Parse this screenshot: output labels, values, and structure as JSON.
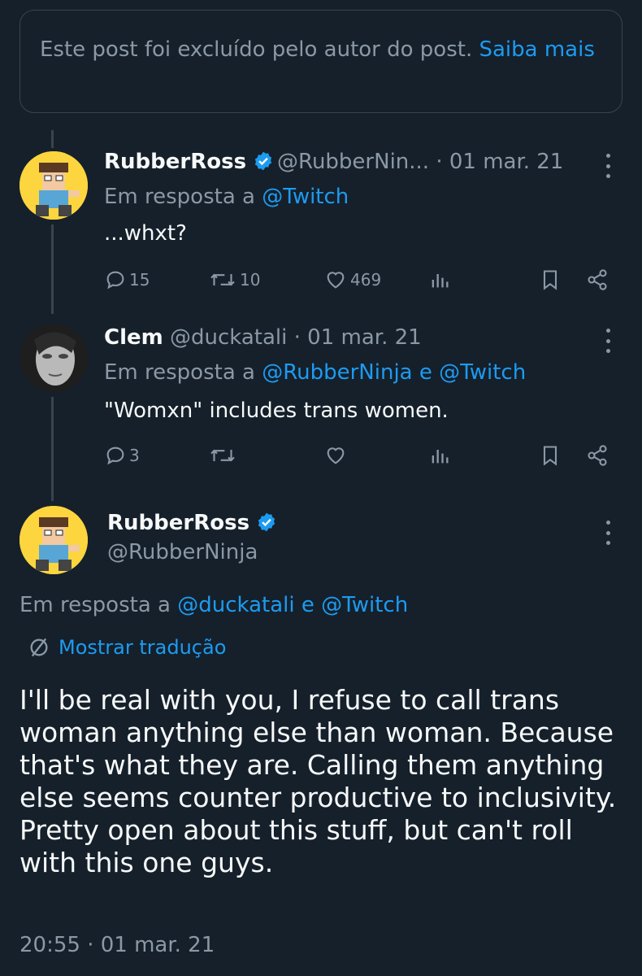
{
  "deleted_notice": {
    "text": "Este post foi excluído pelo autor do post.",
    "link": "Saiba mais"
  },
  "tweets": [
    {
      "name": "RubberRoss",
      "handle": "@RubberNin...",
      "date": "01 mar. 21",
      "reply_prefix": "Em resposta a",
      "reply_to": "@Twitch",
      "text": "...whxt?",
      "replies": "15",
      "retweets": "10",
      "likes": "469"
    },
    {
      "name": "Clem",
      "handle": "@duckatali",
      "date": "01 mar. 21",
      "reply_prefix": "Em resposta a",
      "reply_to": "@RubberNinja e @Twitch",
      "text": "\"Womxn\" includes trans women.",
      "replies": "3",
      "retweets": "",
      "likes": ""
    }
  ],
  "main_tweet": {
    "name": "RubberRoss",
    "handle": "@RubberNinja",
    "reply_prefix": "Em resposta a",
    "reply_to": "@duckatali e @Twitch",
    "translate_label": "Mostrar tradução",
    "text": "I'll be real with you, I refuse to call trans woman anything else than woman. Because that's what they are. Calling them anything else seems counter productive to inclusivity. Pretty open about this stuff, but can't roll with this one guys.",
    "timestamp": "20:55 · 01 mar. 21"
  },
  "colors": {
    "background": "#15202b",
    "accent": "#1d9bf0",
    "muted": "#8b98a5",
    "verified": "#1d9bf0"
  }
}
